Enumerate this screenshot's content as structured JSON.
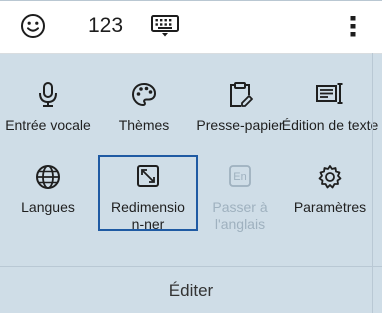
{
  "topbar": {
    "emoji_icon": "smiley-icon",
    "numbers_label": "123",
    "keyboard_icon": "keyboard-icon",
    "more_icon": "more-vertical-icon"
  },
  "grid": {
    "items": [
      {
        "label": "Entrée vocale",
        "icon": "microphone-icon"
      },
      {
        "label": "Thèmes",
        "icon": "palette-icon"
      },
      {
        "label": "Presse-papier",
        "icon": "clipboard-icon"
      },
      {
        "label": "Édition de texte",
        "icon": "text-edit-icon"
      },
      {
        "label": "Langues",
        "icon": "globe-icon"
      },
      {
        "label": "Redimension-ner",
        "icon": "resize-icon"
      },
      {
        "label": "Passer à l'anglais",
        "icon": "english-key-icon",
        "disabled": true
      },
      {
        "label": "Paramètres",
        "icon": "gear-icon"
      }
    ]
  },
  "footer": {
    "label": "Éditer"
  }
}
